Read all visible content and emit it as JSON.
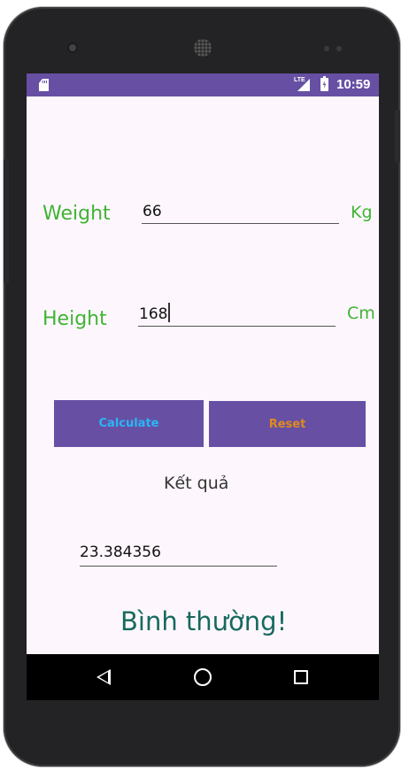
{
  "status_bar": {
    "network_label": "LTE",
    "time": "10:59",
    "icons": [
      "sd-card-icon",
      "signal-icon",
      "battery-charging-icon"
    ]
  },
  "form": {
    "weight_label": "Weight",
    "weight_value": "66",
    "weight_unit": "Kg",
    "height_label": "Height",
    "height_value": "168",
    "height_unit": "Cm"
  },
  "buttons": {
    "calculate_label": "Calculate",
    "reset_label": "Reset"
  },
  "result": {
    "title": "Kết quả",
    "value": "23.384356",
    "verdict": "Bình thường!"
  },
  "nav_bar": {
    "icons": [
      "back-icon",
      "home-icon",
      "recents-icon"
    ]
  },
  "colors": {
    "primary": "#6750a4",
    "label_green": "#3fb434",
    "calculate_text": "#29b6f6",
    "reset_text": "#e08a1e",
    "verdict_text": "#17695e",
    "screen_background": "#fdf7fd"
  }
}
